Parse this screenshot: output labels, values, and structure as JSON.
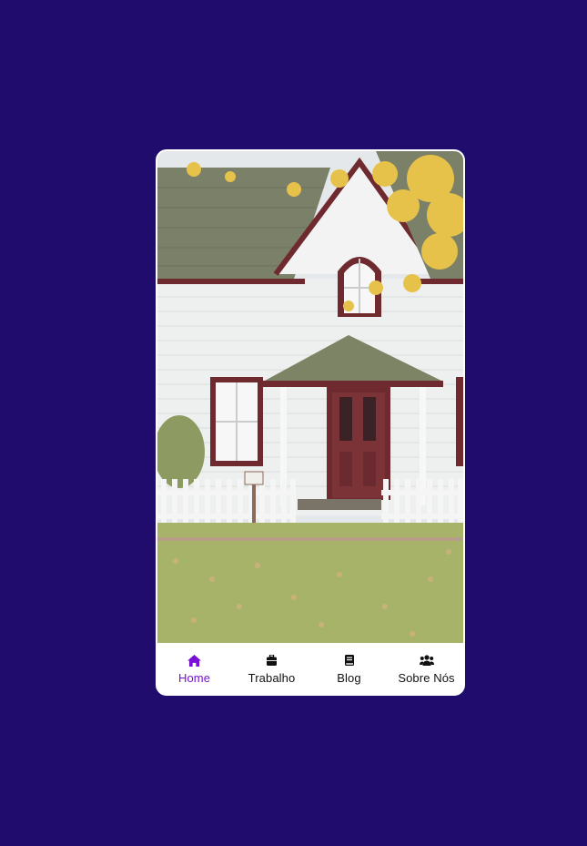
{
  "colors": {
    "background": "#200c6d",
    "card": "#ffffff",
    "active": "#7a0fd6",
    "inactive": "#111111"
  },
  "hero_image": {
    "icon": "white-house-with-picket-fence-photo"
  },
  "nav": {
    "items": [
      {
        "label": "Home",
        "icon": "home-icon",
        "active": true
      },
      {
        "label": "Trabalho",
        "icon": "briefcase-icon",
        "active": false
      },
      {
        "label": "Blog",
        "icon": "book-icon",
        "active": false
      },
      {
        "label": "Sobre Nós",
        "icon": "users-icon",
        "active": false
      }
    ]
  }
}
